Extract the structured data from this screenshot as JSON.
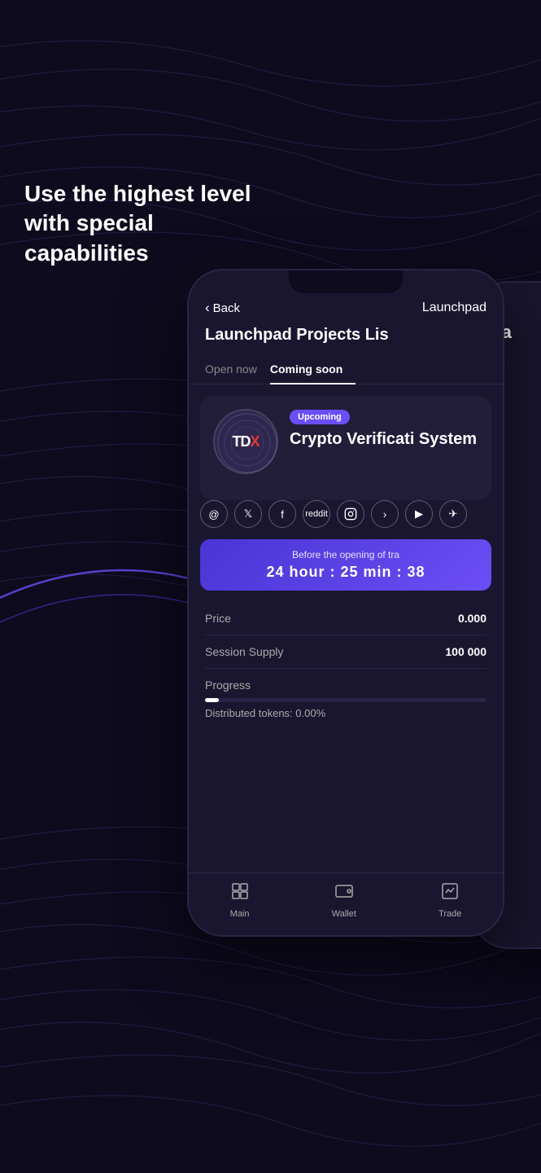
{
  "background": {
    "color": "#0e0b1e"
  },
  "hero": {
    "text": "Use the highest level with special capabilities"
  },
  "phone": {
    "header": {
      "back_label": "Back",
      "title": "Launchpad"
    },
    "page_title": "Launchpad Projects Lis",
    "tabs": [
      {
        "label": "Open now",
        "active": false
      },
      {
        "label": "Coming soon",
        "active": true
      }
    ],
    "card": {
      "badge": "Upcoming",
      "project_name": "Crypto Verificati System",
      "logo_text": "TDX",
      "logo_x": "x"
    },
    "social_icons": [
      {
        "name": "at-icon",
        "symbol": "@"
      },
      {
        "name": "twitter-icon",
        "symbol": "𝕏"
      },
      {
        "name": "facebook-icon",
        "symbol": "f"
      },
      {
        "name": "reddit-icon",
        "symbol": "r"
      },
      {
        "name": "instagram-icon",
        "symbol": "⊕"
      },
      {
        "name": "more-icon",
        "symbol": "…"
      },
      {
        "name": "youtube-icon",
        "symbol": "▶"
      },
      {
        "name": "telegram-icon",
        "symbol": "✈"
      }
    ],
    "countdown": {
      "label": "Before the opening of tra",
      "time": "24 hour : 25 min : 38"
    },
    "details": [
      {
        "label": "Price",
        "value": "0.000"
      },
      {
        "label": "Session Supply",
        "value": "100 000"
      }
    ],
    "progress": {
      "label": "Progress",
      "fill_percent": 5,
      "distributed_text": "Distributed tokens: 0.00%"
    },
    "bottom_nav": [
      {
        "label": "Main",
        "icon": "⊞",
        "name": "main-nav"
      },
      {
        "label": "Wallet",
        "icon": "⬜",
        "name": "wallet-nav"
      },
      {
        "label": "Trade",
        "icon": "⬛",
        "name": "trade-nav"
      }
    ]
  },
  "partial_phone": {
    "label": "Ea"
  }
}
